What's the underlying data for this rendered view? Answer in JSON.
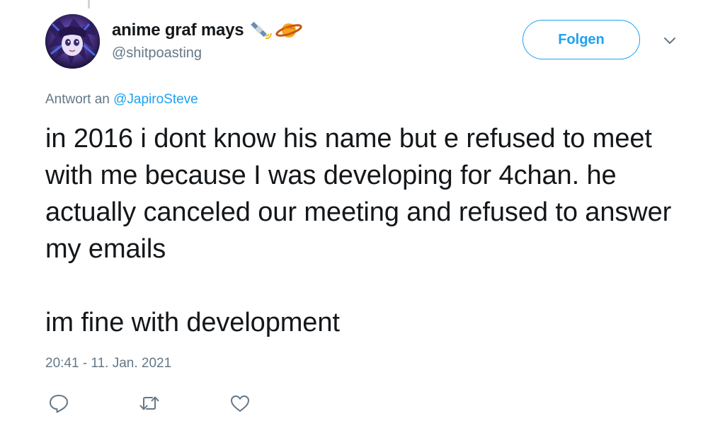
{
  "tweet": {
    "author": {
      "display_name": "anime graf mays",
      "handle": "@shitpoasting",
      "emojis": [
        "satellite-emoji",
        "ringed-planet-emoji"
      ]
    },
    "follow_label": "Folgen",
    "reply_prefix": "Antwort an",
    "reply_mention": "@JapiroSteve",
    "text_paragraphs": [
      "in 2016 i dont know his name but e refused to meet with me because I was developing for 4chan. he actually canceled our meeting and refused to answer my emails",
      "im fine with development"
    ],
    "timestamp": "20:41 - 11. Jan. 2021"
  },
  "actions": {
    "icons": [
      "reply-icon",
      "retweet-icon",
      "like-icon"
    ]
  },
  "colors": {
    "accent": "#1da1f2",
    "text": "#14171a",
    "secondary": "#657786"
  }
}
